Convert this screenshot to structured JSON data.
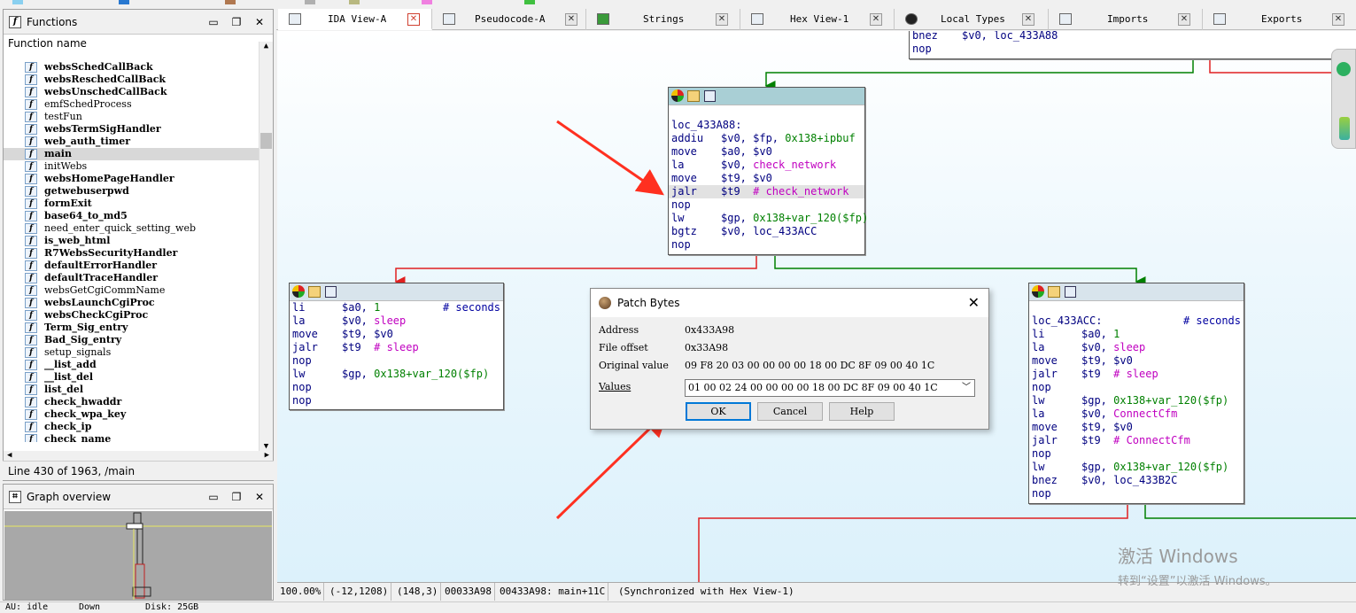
{
  "colors": {
    "accent": "#0078d7",
    "graph_bg": "#dcf1fb",
    "edge_true": "#008000",
    "edge_false": "#e02020",
    "arrow": "#ff3020"
  },
  "functions_panel": {
    "title": "Functions",
    "icon": "function-icon",
    "column_header": "Function name",
    "status": "Line 430 of 1963, /main",
    "items": [
      {
        "name": "websSchedCallBack",
        "bold": true
      },
      {
        "name": "websReschedCallBack",
        "bold": true
      },
      {
        "name": "websUnschedCallBack",
        "bold": true
      },
      {
        "name": "emfSchedProcess",
        "bold": false
      },
      {
        "name": "testFun",
        "bold": false
      },
      {
        "name": "websTermSigHandler",
        "bold": true
      },
      {
        "name": "web_auth_timer",
        "bold": true
      },
      {
        "name": "main",
        "bold": true,
        "selected": true
      },
      {
        "name": "initWebs",
        "bold": false
      },
      {
        "name": "websHomePageHandler",
        "bold": true
      },
      {
        "name": "getwebuserpwd",
        "bold": true
      },
      {
        "name": "formExit",
        "bold": true
      },
      {
        "name": "base64_to_md5",
        "bold": true
      },
      {
        "name": "need_enter_quick_setting_web",
        "bold": false
      },
      {
        "name": "is_web_html",
        "bold": true
      },
      {
        "name": "R7WebsSecurityHandler",
        "bold": true
      },
      {
        "name": "defaultErrorHandler",
        "bold": true
      },
      {
        "name": "defaultTraceHandler",
        "bold": true
      },
      {
        "name": "websGetCgiCommName",
        "bold": false
      },
      {
        "name": "websLaunchCgiProc",
        "bold": true
      },
      {
        "name": "websCheckCgiProc",
        "bold": true
      },
      {
        "name": "Term_Sig_entry",
        "bold": true
      },
      {
        "name": "Bad_Sig_entry",
        "bold": true
      },
      {
        "name": "setup_signals",
        "bold": false
      },
      {
        "name": "__list_add",
        "bold": true
      },
      {
        "name": "__list_del",
        "bold": true
      },
      {
        "name": "list_del",
        "bold": true
      },
      {
        "name": "check_hwaddr",
        "bold": true
      },
      {
        "name": "check_wpa_key",
        "bold": true
      },
      {
        "name": "check_ip",
        "bold": true
      },
      {
        "name": "check_name",
        "bold": true
      }
    ]
  },
  "overview_panel": {
    "title": "Graph overview"
  },
  "tabs": [
    {
      "label": "IDA View-A",
      "active": true
    },
    {
      "label": "Pseudocode-A",
      "active": false
    },
    {
      "label": "Strings",
      "active": false
    },
    {
      "label": "Hex View-1",
      "active": false
    },
    {
      "label": "Local Types",
      "active": false
    },
    {
      "label": "Imports",
      "active": false
    },
    {
      "label": "Exports",
      "active": false
    }
  ],
  "graph": {
    "top_node": [
      {
        "op": "bnez",
        "args": "$v0, loc_433A88"
      },
      {
        "op": "nop",
        "args": ""
      }
    ],
    "main_node": {
      "label": "loc_433A88:",
      "lines": [
        {
          "op": "addiu",
          "a": "$v0, $fp, ",
          "g": "0x138+ipbuf",
          "m": "",
          "c": ""
        },
        {
          "op": "move",
          "a": "$a0, $v0",
          "g": "",
          "m": "",
          "c": ""
        },
        {
          "op": "la",
          "a": "$v0, ",
          "g": "",
          "m": "check_network",
          "c": ""
        },
        {
          "op": "move",
          "a": "$t9, $v0",
          "g": "",
          "m": "",
          "c": ""
        },
        {
          "op": "jalr",
          "a": "$t9  ",
          "g": "",
          "m": "",
          "c": "# check_network",
          "hl": true
        },
        {
          "op": "nop",
          "a": "",
          "g": "",
          "m": "",
          "c": ""
        },
        {
          "op": "lw",
          "a": "$gp, ",
          "g": "0x138+var_120($fp)",
          "m": "",
          "c": ""
        },
        {
          "op": "bgtz",
          "a": "$v0, loc_433ACC",
          "g": "",
          "m": "",
          "c": ""
        },
        {
          "op": "nop",
          "a": "",
          "g": "",
          "m": "",
          "c": ""
        }
      ]
    },
    "left_node": [
      {
        "op": "li",
        "a": "$a0, ",
        "g": "1",
        "m": "",
        "c": "# seconds"
      },
      {
        "op": "la",
        "a": "$v0, ",
        "g": "",
        "m": "sleep",
        "c": ""
      },
      {
        "op": "move",
        "a": "$t9, $v0",
        "g": "",
        "m": "",
        "c": ""
      },
      {
        "op": "jalr",
        "a": "$t9  ",
        "g": "",
        "m": "",
        "c": "# sleep"
      },
      {
        "op": "nop",
        "a": "",
        "g": "",
        "m": "",
        "c": ""
      },
      {
        "op": "lw",
        "a": "$gp, ",
        "g": "0x138+var_120($fp)",
        "m": "",
        "c": ""
      },
      {
        "op": "nop",
        "a": "",
        "g": "",
        "m": "",
        "c": ""
      },
      {
        "op": "nop",
        "a": "",
        "g": "",
        "m": "",
        "c": ""
      }
    ],
    "right_node": {
      "label": "loc_433ACC:",
      "label_comment": "# seconds",
      "lines": [
        {
          "op": "li",
          "a": "$a0, ",
          "g": "1",
          "m": "",
          "c": ""
        },
        {
          "op": "la",
          "a": "$v0, ",
          "g": "",
          "m": "sleep",
          "c": ""
        },
        {
          "op": "move",
          "a": "$t9, $v0",
          "g": "",
          "m": "",
          "c": ""
        },
        {
          "op": "jalr",
          "a": "$t9  ",
          "g": "",
          "m": "",
          "c": "# sleep"
        },
        {
          "op": "nop",
          "a": "",
          "g": "",
          "m": "",
          "c": ""
        },
        {
          "op": "lw",
          "a": "$gp, ",
          "g": "0x138+var_120($fp)",
          "m": "",
          "c": ""
        },
        {
          "op": "la",
          "a": "$v0, ",
          "g": "",
          "m": "ConnectCfm",
          "c": ""
        },
        {
          "op": "move",
          "a": "$t9, $v0",
          "g": "",
          "m": "",
          "c": ""
        },
        {
          "op": "jalr",
          "a": "$t9  ",
          "g": "",
          "m": "",
          "c": "# ConnectCfm"
        },
        {
          "op": "nop",
          "a": "",
          "g": "",
          "m": "",
          "c": ""
        },
        {
          "op": "lw",
          "a": "$gp, ",
          "g": "0x138+var_120($fp)",
          "m": "",
          "c": ""
        },
        {
          "op": "bnez",
          "a": "$v0, loc_433B2C",
          "g": "",
          "m": "",
          "c": ""
        },
        {
          "op": "nop",
          "a": "",
          "g": "",
          "m": "",
          "c": ""
        }
      ]
    }
  },
  "dialog": {
    "title": "Patch Bytes",
    "address_label": "Address",
    "address": "0x433A98",
    "offset_label": "File offset",
    "offset": "0x33A98",
    "orig_label": "Original value",
    "orig": "09 F8 20 03 00 00 00 00 18 00 DC 8F 09 00 40 1C",
    "values_label": "Values",
    "values": "01 00 02 24 00 00 00 00 18 00 DC 8F 09 00 40 1C",
    "ok": "OK",
    "cancel": "Cancel",
    "help": "Help"
  },
  "statusbar": [
    "100.00%",
    "(-12,1208)",
    "(148,3)",
    "00033A98",
    "00433A98: main+11C",
    "(Synchronized with Hex View-1)"
  ],
  "bottom": {
    "au": "AU:  idle",
    "down": "Down",
    "disk": "Disk: 25GB"
  },
  "watermark": {
    "line1": "激活 Windows",
    "line2": "转到“设置”以激活 Windows。"
  }
}
